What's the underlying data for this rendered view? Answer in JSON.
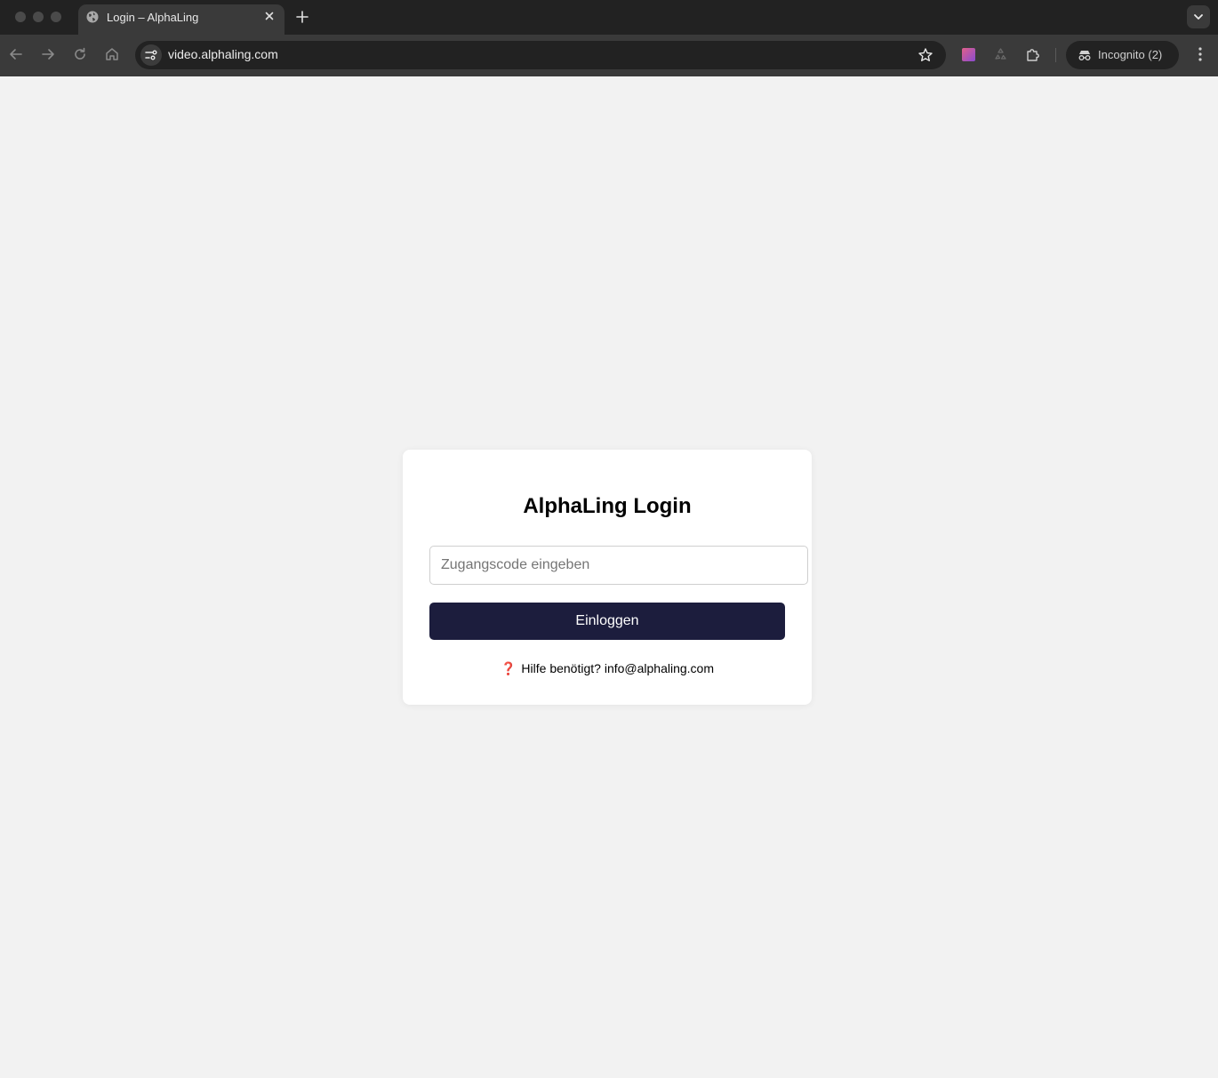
{
  "browser": {
    "tab": {
      "title": "Login – AlphaLing"
    },
    "address_bar": {
      "url": "video.alphaling.com"
    },
    "profile": {
      "label": "Incognito (2)"
    }
  },
  "login": {
    "title": "AlphaLing Login",
    "code_input": {
      "placeholder": "Zugangscode eingeben",
      "value": ""
    },
    "submit_label": "Einloggen",
    "help": {
      "icon": "question-mark-icon",
      "icon_glyph": "❓",
      "text": "Hilfe benötigt?",
      "email": "info@alphaling.com"
    }
  },
  "colors": {
    "page_background": "#f2f2f2",
    "button_background": "#1c1d3d",
    "help_icon": "#d5202a"
  }
}
